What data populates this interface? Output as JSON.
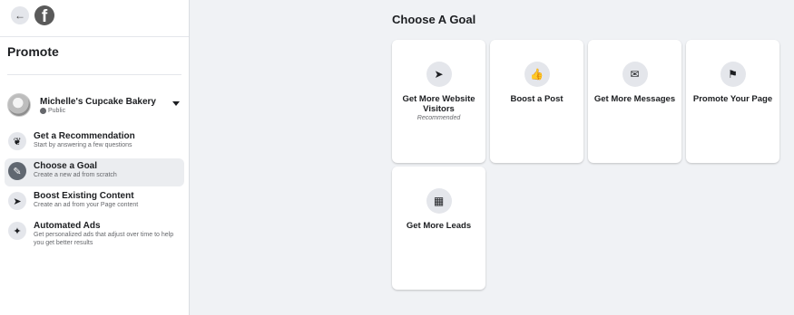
{
  "nav": {
    "back_icon": "arrow-left-icon",
    "logo": "facebook-logo"
  },
  "sidebar": {
    "title": "Promote",
    "page": {
      "name": "Michelle's Cupcake Bakery",
      "privacy": "Public"
    },
    "items": [
      {
        "title": "Get a Recommendation",
        "subtitle": "Start by answering a few questions",
        "icon": "plant-icon",
        "active": false
      },
      {
        "title": "Choose a Goal",
        "subtitle": "Create a new ad from scratch",
        "icon": "edit-icon",
        "active": true
      },
      {
        "title": "Boost Existing Content",
        "subtitle": "Create an ad from your Page content",
        "icon": "rocket-icon",
        "active": false
      },
      {
        "title": "Automated Ads",
        "subtitle": "Get personalized ads that adjust over time to help you get better results",
        "icon": "magic-wand-icon",
        "active": false
      }
    ]
  },
  "main": {
    "title": "Choose A Goal",
    "cards": [
      {
        "label": "Get More Website Visitors",
        "note": "Recommended",
        "icon": "cursor-icon"
      },
      {
        "label": "Boost a Post",
        "note": "",
        "icon": "thumbs-up-icon"
      },
      {
        "label": "Get More Messages",
        "note": "",
        "icon": "chat-bubble-icon"
      },
      {
        "label": "Promote Your Page",
        "note": "",
        "icon": "flag-icon"
      },
      {
        "label": "Get More Leads",
        "note": "",
        "icon": "contact-card-icon"
      }
    ]
  },
  "colors": {
    "background": "#f0f2f5",
    "active_item": "#ebedf0",
    "icon_bg": "#e4e6eb"
  }
}
